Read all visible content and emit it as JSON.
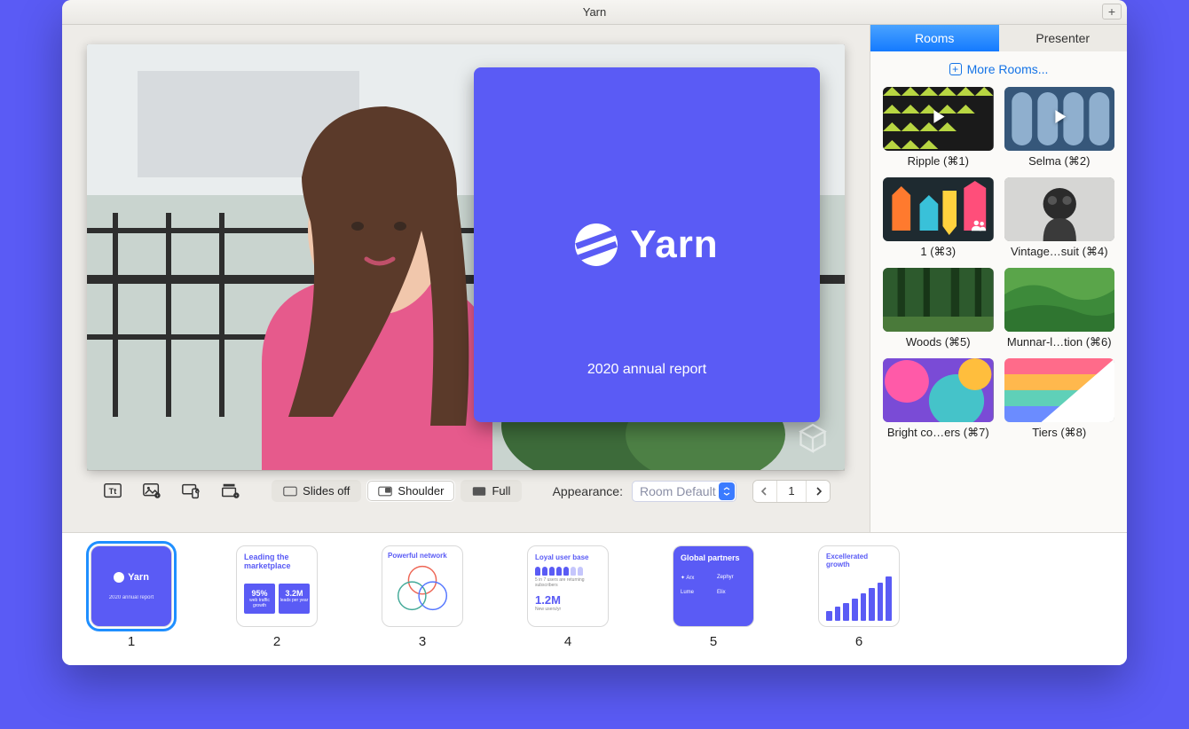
{
  "window": {
    "title": "Yarn"
  },
  "overlay": {
    "brand": "Yarn",
    "subtitle": "2020 annual report"
  },
  "toolbar": {
    "slides_off": "Slides off",
    "shoulder": "Shoulder",
    "full": "Full",
    "appearance_label": "Appearance:",
    "appearance_value": "Room Default",
    "page": "1"
  },
  "sidebar": {
    "tabs": {
      "rooms": "Rooms",
      "presenter": "Presenter"
    },
    "more": "More Rooms...",
    "rooms": [
      {
        "label": "Ripple (⌘1)"
      },
      {
        "label": "Selma (⌘2)"
      },
      {
        "label": "1 (⌘3)"
      },
      {
        "label": "Vintage…suit (⌘4)"
      },
      {
        "label": "Woods (⌘5)"
      },
      {
        "label": "Munnar-l…tion (⌘6)"
      },
      {
        "label": "Bright co…ers (⌘7)"
      },
      {
        "label": "Tiers (⌘8)"
      }
    ]
  },
  "slides": [
    {
      "num": "1",
      "title": "Yarn",
      "sub": "2020 annual report"
    },
    {
      "num": "2",
      "title": "Leading the marketplace",
      "a": "95%",
      "b": "3.2M"
    },
    {
      "num": "3",
      "title": "Powerful network"
    },
    {
      "num": "4",
      "title": "Loyal user base",
      "metric": "1.2M"
    },
    {
      "num": "5",
      "title": "Global partners"
    },
    {
      "num": "6",
      "title": "Excellerated growth"
    }
  ]
}
